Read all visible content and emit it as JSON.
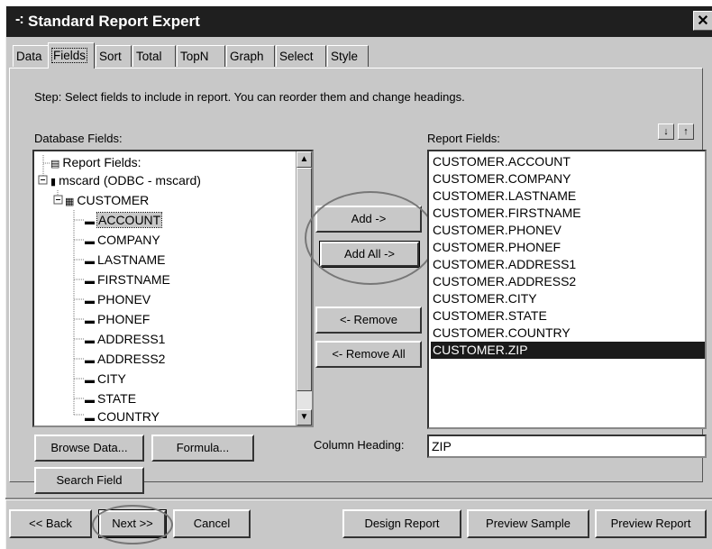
{
  "window": {
    "title": "Standard Report Expert",
    "close_label": "✕"
  },
  "tabs": [
    "Data",
    "Fields",
    "Sort",
    "Total",
    "TopN",
    "Graph",
    "Select",
    "Style"
  ],
  "active_tab": "Fields",
  "step_text": "Step:  Select fields to include in report.  You can reorder them and change headings.",
  "database_fields": {
    "label": "Database Fields:",
    "tree": [
      {
        "text": "Report Fields:",
        "icon": "report-icon"
      },
      {
        "text": "mscard (ODBC - mscard)",
        "icon": "database-icon"
      },
      {
        "text": "CUSTOMER",
        "icon": "table-icon"
      },
      {
        "text": "ACCOUNT",
        "icon": "field-icon",
        "selected": true
      },
      {
        "text": "COMPANY",
        "icon": "field-icon"
      },
      {
        "text": "LASTNAME",
        "icon": "field-icon"
      },
      {
        "text": "FIRSTNAME",
        "icon": "field-icon"
      },
      {
        "text": "PHONEV",
        "icon": "field-icon"
      },
      {
        "text": "PHONEF",
        "icon": "field-icon"
      },
      {
        "text": "ADDRESS1",
        "icon": "field-icon"
      },
      {
        "text": "ADDRESS2",
        "icon": "field-icon"
      },
      {
        "text": "CITY",
        "icon": "field-icon"
      },
      {
        "text": "STATE",
        "icon": "field-icon"
      },
      {
        "text": "COUNTRY",
        "icon": "field-icon"
      }
    ]
  },
  "report_fields": {
    "label": "Report Fields:",
    "items": [
      "CUSTOMER.ACCOUNT",
      "CUSTOMER.COMPANY",
      "CUSTOMER.LASTNAME",
      "CUSTOMER.FIRSTNAME",
      "CUSTOMER.PHONEV",
      "CUSTOMER.PHONEF",
      "CUSTOMER.ADDRESS1",
      "CUSTOMER.ADDRESS2",
      "CUSTOMER.CITY",
      "CUSTOMER.STATE",
      "CUSTOMER.COUNTRY",
      "CUSTOMER.ZIP"
    ],
    "selected": "CUSTOMER.ZIP"
  },
  "buttons": {
    "add": "Add ->",
    "add_all": "Add All ->",
    "remove": "<- Remove",
    "remove_all": "<- Remove All",
    "browse_data": "Browse Data...",
    "formula": "Formula...",
    "search_field": "Search Field",
    "back": "<< Back",
    "next": "Next >>",
    "cancel": "Cancel",
    "design_report": "Design Report",
    "preview_sample": "Preview Sample",
    "preview_report": "Preview Report",
    "move_down": "↓",
    "move_up": "↑"
  },
  "column_heading": {
    "label": "Column Heading:",
    "value": "ZIP"
  },
  "colors": {
    "titlebar": "#1f1f1f",
    "dialog": "#c8c8c8",
    "selection": "#1a1a1a"
  }
}
